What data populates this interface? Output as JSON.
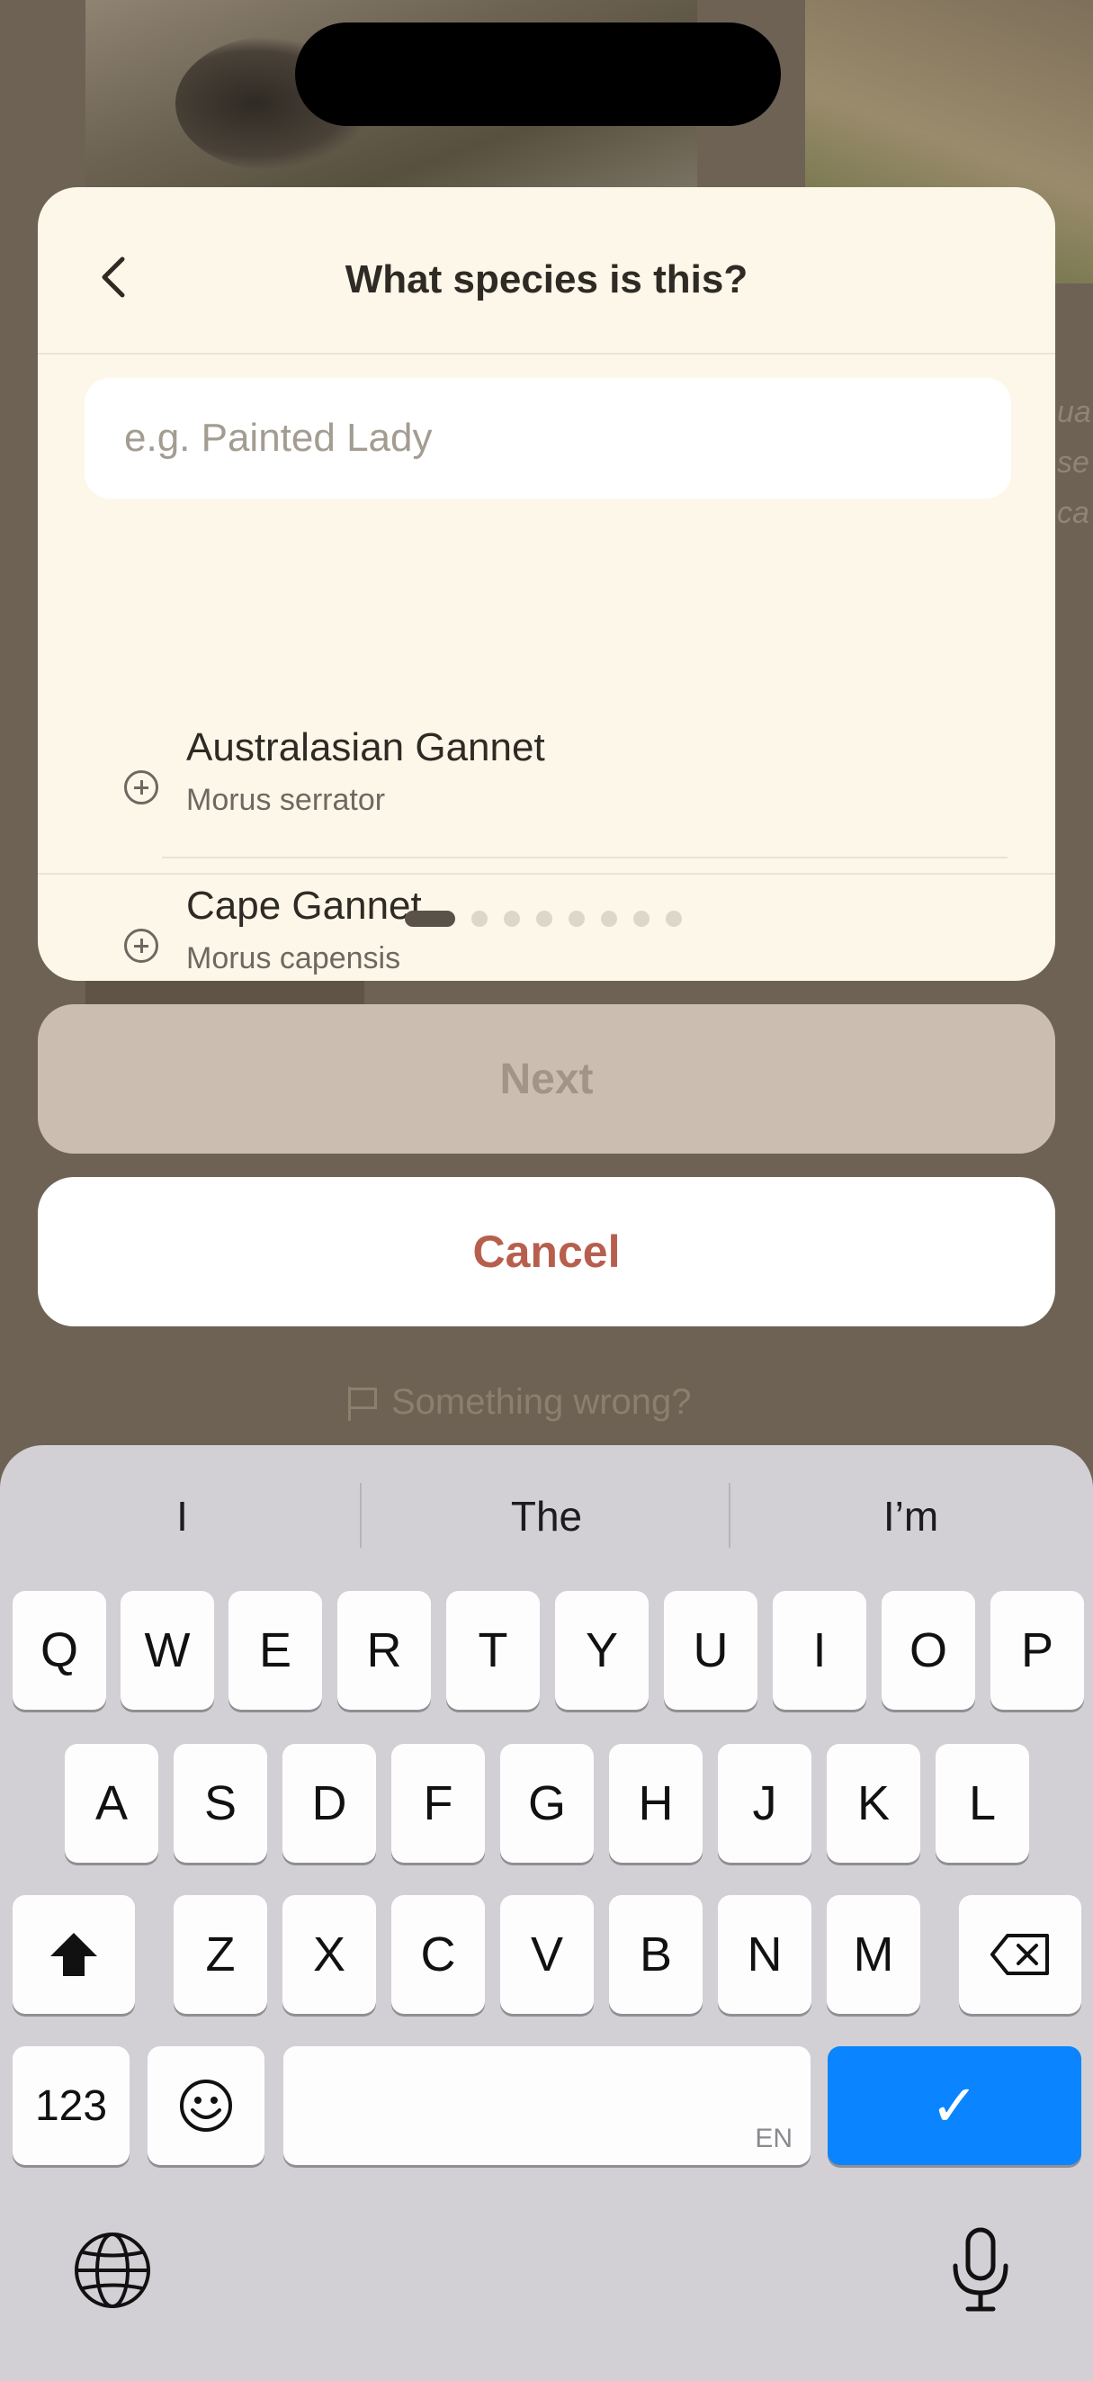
{
  "background": {
    "side_text": [
      "ua",
      "se",
      "ca"
    ],
    "something_wrong": "Something wrong?"
  },
  "modal": {
    "title": "What species is this?",
    "search": {
      "placeholder": "e.g. Painted Lady",
      "value": ""
    },
    "results": [
      {
        "common_name": "Australasian Gannet",
        "scientific_name": "Morus serrator"
      },
      {
        "common_name": "Cape Gannet",
        "scientific_name": "Morus capensis"
      }
    ],
    "page_indicator": {
      "total": 9,
      "current": 1
    }
  },
  "actions": {
    "next_label": "Next",
    "cancel_label": "Cancel"
  },
  "keyboard": {
    "suggestions": [
      "I",
      "The",
      "I’m"
    ],
    "row1": [
      "Q",
      "W",
      "E",
      "R",
      "T",
      "Y",
      "U",
      "I",
      "O",
      "P"
    ],
    "row2": [
      "A",
      "S",
      "D",
      "F",
      "G",
      "H",
      "J",
      "K",
      "L"
    ],
    "row3": [
      "Z",
      "X",
      "C",
      "V",
      "B",
      "N",
      "M"
    ],
    "numbers_label": "123",
    "language_label": "EN",
    "done_symbol": "✓"
  },
  "colors": {
    "accent": "#b75f4d",
    "done_key": "#0a84ff",
    "card_bg": "#fdf7ea"
  }
}
